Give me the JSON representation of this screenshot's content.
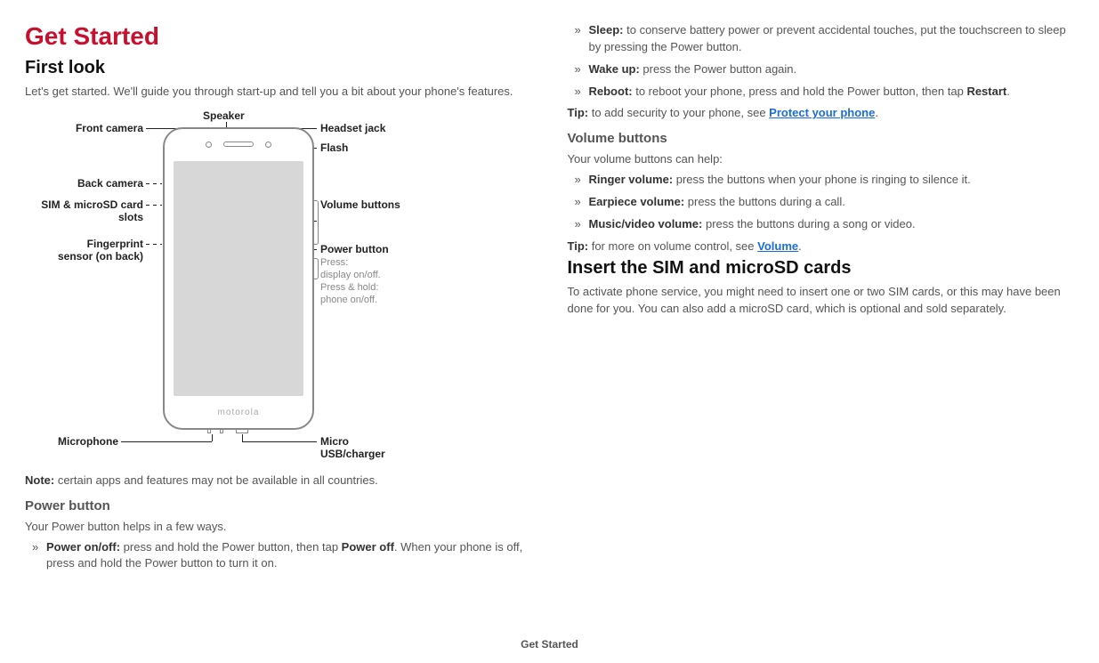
{
  "h1": "Get Started",
  "firstLook": {
    "title": "First look",
    "intro": "Let's get started. We'll guide you through start-up and tell you a bit about your phone's features.",
    "labels": {
      "speaker": "Speaker",
      "frontCamera": "Front camera",
      "headsetJack": "Headset jack",
      "flash": "Flash",
      "backCamera": "Back camera",
      "simSlots": "SIM & microSD card slots",
      "fingerprint": "Fingerprint sensor (on back)",
      "volumeButtons": "Volume buttons",
      "powerButton": "Power button",
      "powerButtonSub1": "Press:",
      "powerButtonSub2": "display on/off.",
      "powerButtonSub3": "Press & hold:",
      "powerButtonSub4": "phone on/off.",
      "microphone": "Microphone",
      "microUsb": "Micro USB/charger",
      "brand": "motorola"
    },
    "noteLabel": "Note:",
    "note": " certain apps and features may not be available in all countries."
  },
  "powerButton": {
    "title": "Power button",
    "intro": "Your Power button helps in a few ways.",
    "items": {
      "powerOnOff": {
        "label": "Power on/off:",
        "text": " press and hold the Power button, then tap ",
        "bold2": "Power off",
        "text2": ". When your phone is off, press and hold the Power button to turn it on."
      },
      "sleep": {
        "label": "Sleep:",
        "text": " to conserve battery power or prevent accidental touches, put the touchscreen to sleep by pressing the Power button."
      },
      "wakeUp": {
        "label": "Wake up:",
        "text": " press the Power button again."
      },
      "reboot": {
        "label": "Reboot:",
        "text": " to reboot your phone, press and hold the Power button, then tap ",
        "bold2": "Restart",
        "text2": "."
      }
    },
    "tipLabel": "Tip:",
    "tipText": " to add security to your phone, see ",
    "tipLink": "Protect your phone"
  },
  "volumeButtons": {
    "title": "Volume buttons",
    "intro": "Your volume buttons can help:",
    "items": {
      "ringer": {
        "label": "Ringer volume:",
        "text": " press the buttons when your phone is ringing to silence it."
      },
      "earpiece": {
        "label": "Earpiece volume:",
        "text": " press the buttons during a call."
      },
      "music": {
        "label": "Music/video volume:",
        "text": " press the buttons during a song or video."
      }
    },
    "tipLabel": "Tip:",
    "tipText": " for more on volume control, see ",
    "tipLink": "Volume"
  },
  "insertSim": {
    "title": "Insert the SIM and microSD cards",
    "text": "To activate phone service, you might need to insert one or two SIM cards, or this may have been done for you. You can also add a microSD card, which is optional and sold separately."
  },
  "footer": "Get Started"
}
